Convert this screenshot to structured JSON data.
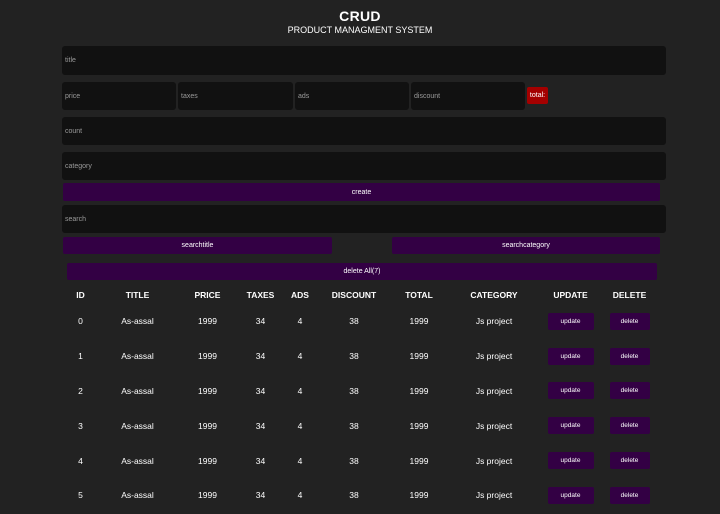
{
  "header": {
    "title": "CRUD",
    "subtitle": "PRODUCT MANAGMENT SYSTEM"
  },
  "form": {
    "title_placeholder": "title",
    "price_placeholder": "price",
    "taxes_placeholder": "taxes",
    "ads_placeholder": "ads",
    "discount_placeholder": "discount",
    "total_label": "total:",
    "count_placeholder": "count",
    "category_placeholder": "category",
    "create_label": "create"
  },
  "search": {
    "placeholder": "search",
    "by_title_label": "searchtitle",
    "by_category_label": "searchcategory"
  },
  "delete_all_label": "delete All(7)",
  "table": {
    "headers": [
      "ID",
      "TITLE",
      "PRICE",
      "TAXES",
      "ADS",
      "DISCOUNT",
      "TOTAL",
      "CATEGORY",
      "UPDATE",
      "DELETE"
    ],
    "update_label": "update",
    "delete_label": "delete",
    "rows": [
      {
        "id": "0",
        "title": "As-assal",
        "price": "1999",
        "taxes": "34",
        "ads": "4",
        "discount": "38",
        "total": "1999",
        "category": "Js project"
      },
      {
        "id": "1",
        "title": "As-assal",
        "price": "1999",
        "taxes": "34",
        "ads": "4",
        "discount": "38",
        "total": "1999",
        "category": "Js project"
      },
      {
        "id": "2",
        "title": "As-assal",
        "price": "1999",
        "taxes": "34",
        "ads": "4",
        "discount": "38",
        "total": "1999",
        "category": "Js project"
      },
      {
        "id": "3",
        "title": "As-assal",
        "price": "1999",
        "taxes": "34",
        "ads": "4",
        "discount": "38",
        "total": "1999",
        "category": "Js project"
      },
      {
        "id": "4",
        "title": "As-assal",
        "price": "1999",
        "taxes": "34",
        "ads": "4",
        "discount": "38",
        "total": "1999",
        "category": "Js project"
      },
      {
        "id": "5",
        "title": "As-assal",
        "price": "1999",
        "taxes": "34",
        "ads": "4",
        "discount": "38",
        "total": "1999",
        "category": "Js project"
      }
    ]
  },
  "colors": {
    "background": "#222222",
    "input_background": "#111111",
    "button_purple": "#330044",
    "total_red": "#a40000"
  }
}
